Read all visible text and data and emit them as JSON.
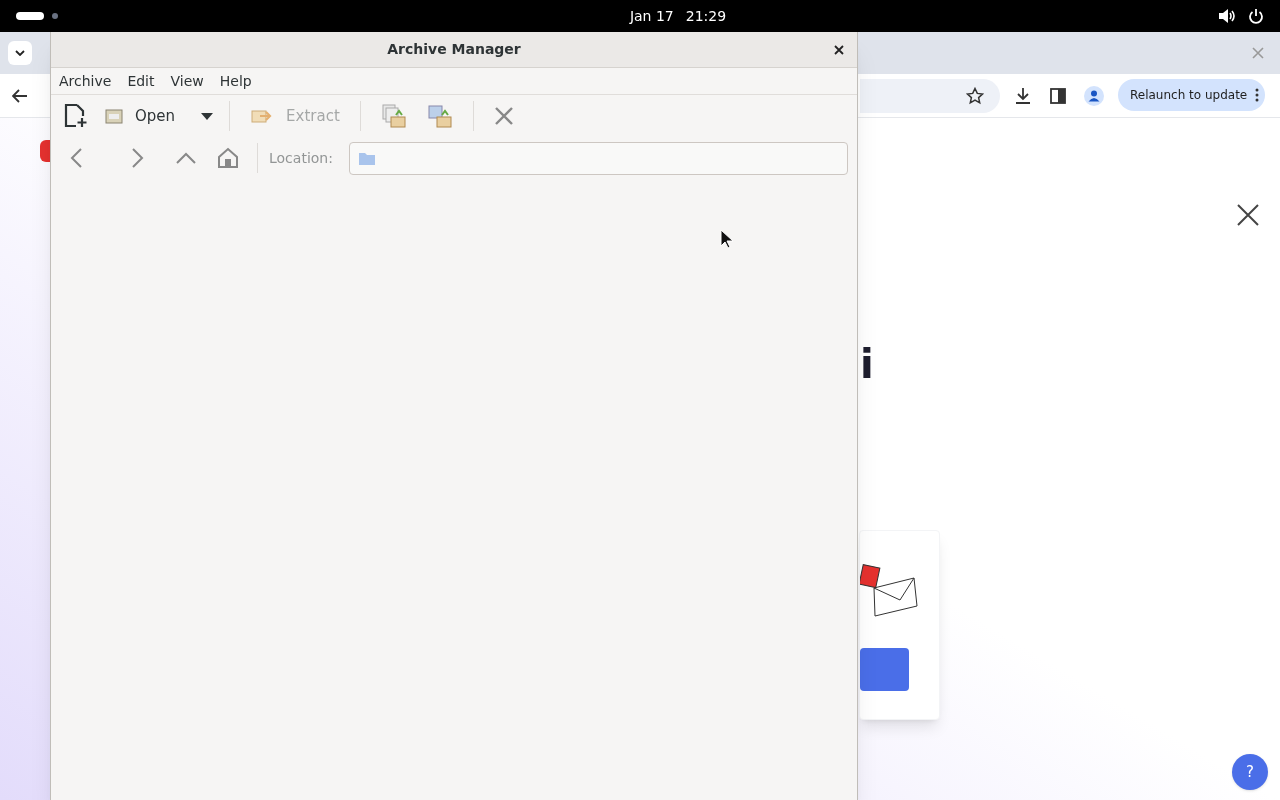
{
  "top_bar": {
    "date": "Jan 17",
    "time": "21:29"
  },
  "browser": {
    "update_button": "Relaunch to update",
    "heading_fragment": "i",
    "help_button": "?"
  },
  "archive_window": {
    "title": "Archive Manager",
    "menu": [
      "Archive",
      "Edit",
      "View",
      "Help"
    ],
    "toolbar": [
      {
        "label": "Open",
        "disabled": false
      },
      {
        "label": "Extract",
        "disabled": true
      }
    ],
    "location_label": "Location:"
  }
}
